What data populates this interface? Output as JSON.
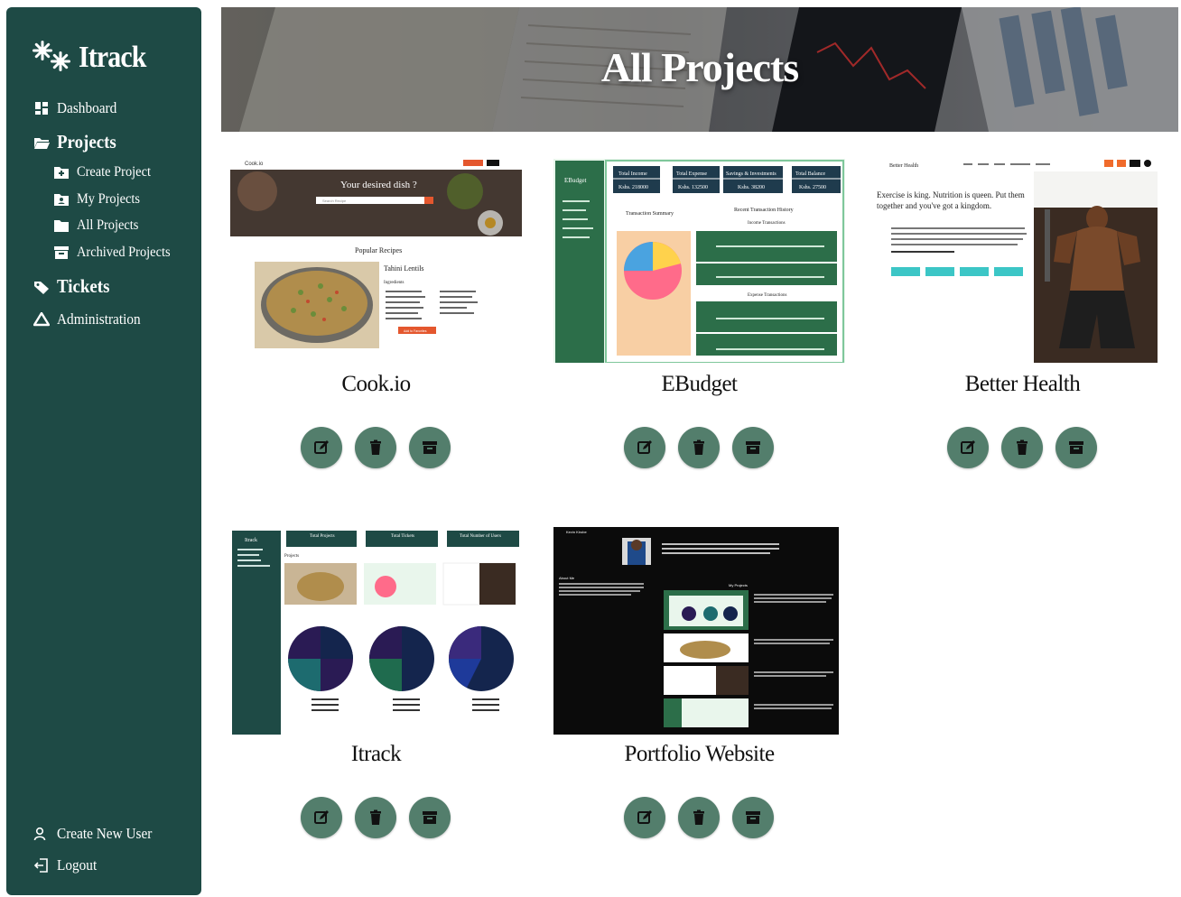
{
  "sidebar": {
    "brand": "Itrack",
    "dashboard": "Dashboard",
    "projects": "Projects",
    "create_project": "Create Project",
    "my_projects": "My Projects",
    "all_projects": "All Projects",
    "archived_projects": "Archived Projects",
    "tickets": "Tickets",
    "administration": "Administration",
    "create_new_user": "Create New User",
    "logout": "Logout"
  },
  "banner": {
    "title": "All Projects"
  },
  "projects": [
    {
      "name": "Cook.io"
    },
    {
      "name": "EBudget"
    },
    {
      "name": "Better Health"
    },
    {
      "name": "Itrack"
    },
    {
      "name": "Portfolio Website"
    }
  ],
  "thumbs": {
    "cookio": {
      "logo": "Cook.io",
      "hero": "Your desired dish ?",
      "search": "Search Recipe",
      "popular": "Popular Recipes",
      "recipe": "Tahini Lentils",
      "ingredients": "Ingredients",
      "add_btn": "Add to Favorites"
    },
    "ebudget": {
      "logo": "EBudget",
      "cards": [
        "Total Income",
        "Total Expense",
        "Savings & Investments",
        "Total Balance"
      ],
      "values": [
        "Kshs. 218000",
        "Kshs. 132500",
        "Kshs. 38200",
        "Kshs. 27500"
      ],
      "summary": "Transaction Summary",
      "history": "Recent Transaction History",
      "income_tx": "Income Transactions",
      "expense_tx": "Expense Transactions"
    },
    "health": {
      "logo": "Better Health",
      "headline": "Exercise is king. Nutrition is queen. Put them together and you've got a kingdom."
    },
    "itrack": {
      "logo": "Itrack",
      "cards": [
        "Total Projects",
        "Total Tickets",
        "Total Number of Users"
      ],
      "projects": "Projects"
    },
    "portfolio": {
      "name": "Kevin Kirobe",
      "about": "About Me",
      "my_projects": "My Projects"
    }
  },
  "colors": {
    "sidebar": "#1e4a45",
    "action_button": "#537e6c",
    "ebudget_green": "#2c6e49",
    "cook_orange": "#e4572e"
  },
  "icons": {
    "edit": "edit-icon",
    "delete": "trash-icon",
    "archive": "archive-icon"
  }
}
